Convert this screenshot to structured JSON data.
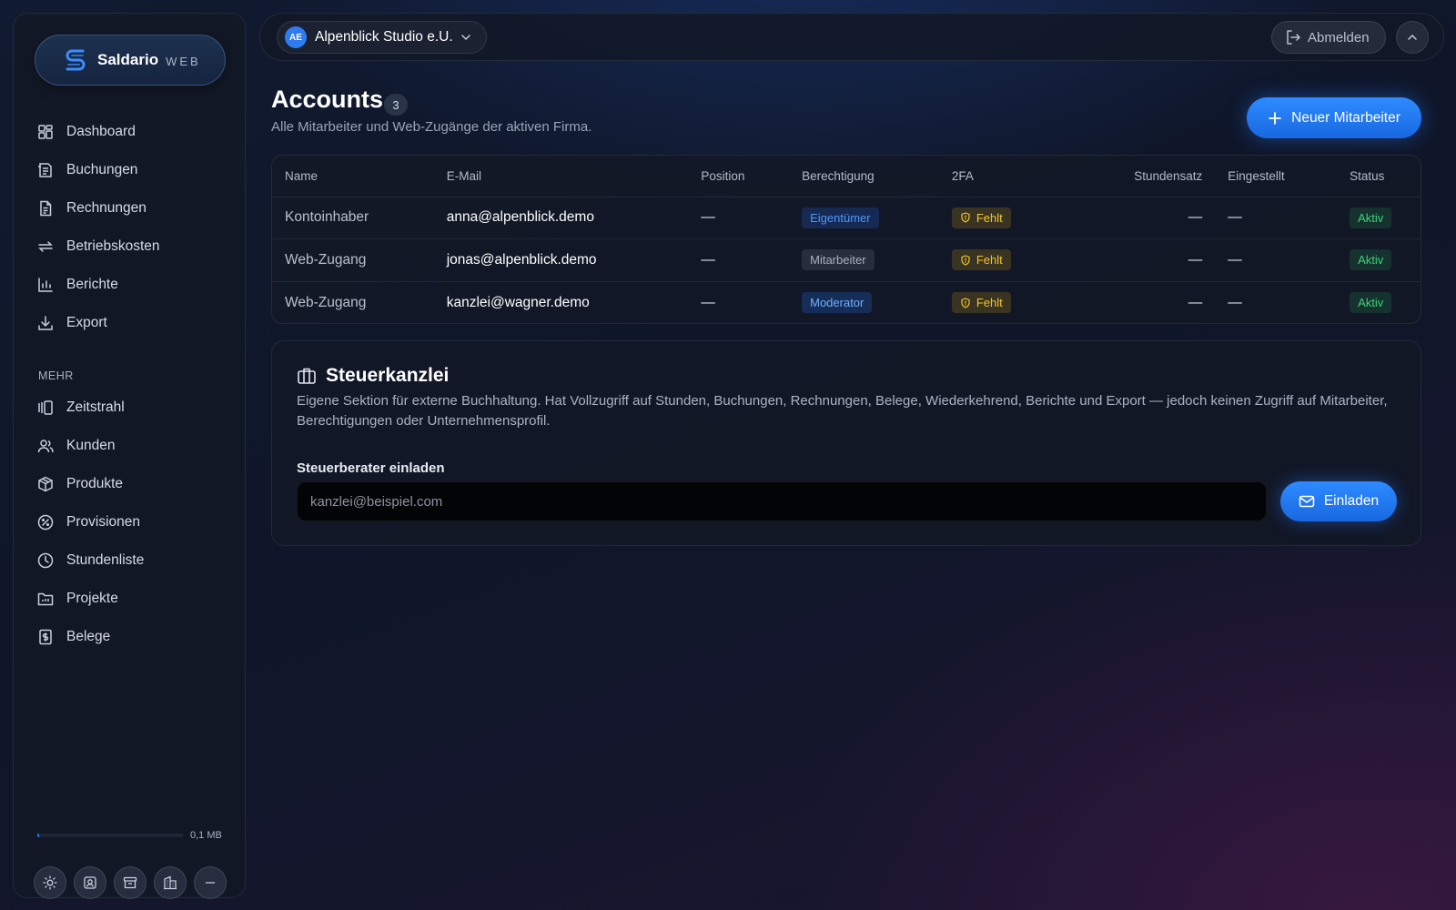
{
  "brand": {
    "name": "Saldario",
    "sub": "WEB"
  },
  "sidebar": {
    "main_items": [
      {
        "label": "Dashboard",
        "icon": "dashboard-icon"
      },
      {
        "label": "Buchungen",
        "icon": "bookings-icon"
      },
      {
        "label": "Rechnungen",
        "icon": "invoice-icon"
      },
      {
        "label": "Betriebskosten",
        "icon": "repeat-icon"
      },
      {
        "label": "Berichte",
        "icon": "chart-icon"
      },
      {
        "label": "Export",
        "icon": "download-icon"
      }
    ],
    "section_label": "MEHR",
    "more_items": [
      {
        "label": "Zeitstrahl",
        "icon": "timeline-icon"
      },
      {
        "label": "Kunden",
        "icon": "users-icon"
      },
      {
        "label": "Produkte",
        "icon": "box-icon"
      },
      {
        "label": "Provisionen",
        "icon": "percent-icon"
      },
      {
        "label": "Stundenliste",
        "icon": "clock-icon"
      },
      {
        "label": "Projekte",
        "icon": "folder-icon"
      },
      {
        "label": "Belege",
        "icon": "receipt-icon"
      }
    ],
    "storage": {
      "used_label": "0,1 MB",
      "fraction": 0.01
    },
    "bottom_icons": [
      "sun-icon",
      "contact-icon",
      "archive-icon",
      "building-icon",
      "minus-icon"
    ]
  },
  "topbar": {
    "company_initials": "AE",
    "company_name": "Alpenblick Studio e.U.",
    "logout_label": "Abmelden"
  },
  "page": {
    "title": "Accounts",
    "count": "3",
    "subtitle": "Alle Mitarbeiter und Web-Zugänge der aktiven Firma.",
    "new_button": "Neuer Mitarbeiter"
  },
  "table": {
    "headers": [
      "Name",
      "E-Mail",
      "Position",
      "Berechtigung",
      "2FA",
      "Stundensatz",
      "Eingestellt",
      "Status"
    ],
    "rows": [
      {
        "name": "Kontoinhaber",
        "email": "anna@alpenblick.demo",
        "position": "—",
        "role": "Eigentümer",
        "twofa": "Fehlt",
        "rate": "—",
        "hired": "—",
        "status": "Aktiv"
      },
      {
        "name": "Web-Zugang",
        "email": "jonas@alpenblick.demo",
        "position": "—",
        "role": "Mitarbeiter",
        "twofa": "Fehlt",
        "rate": "—",
        "hired": "—",
        "status": "Aktiv"
      },
      {
        "name": "Web-Zugang",
        "email": "kanzlei@wagner.demo",
        "position": "—",
        "role": "Moderator",
        "twofa": "Fehlt",
        "rate": "—",
        "hired": "—",
        "status": "Aktiv"
      }
    ]
  },
  "tax": {
    "title": "Steuerkanzlei",
    "description": "Eigene Sektion für externe Buchhaltung. Hat Vollzugriff auf Stunden, Buchungen, Rechnungen, Belege, Wiederkehrend, Berichte und Export — jedoch keinen Zugriff auf Mitarbeiter, Berechtigungen oder Unternehmensprofil.",
    "invite_label": "Steuerberater einladen",
    "input_value": "",
    "input_placeholder": "kanzlei@beispiel.com",
    "invite_button": "Einladen"
  },
  "colors": {
    "accent": "#2f7cf0",
    "warning": "#f3c52f",
    "success": "#3fd07a"
  }
}
